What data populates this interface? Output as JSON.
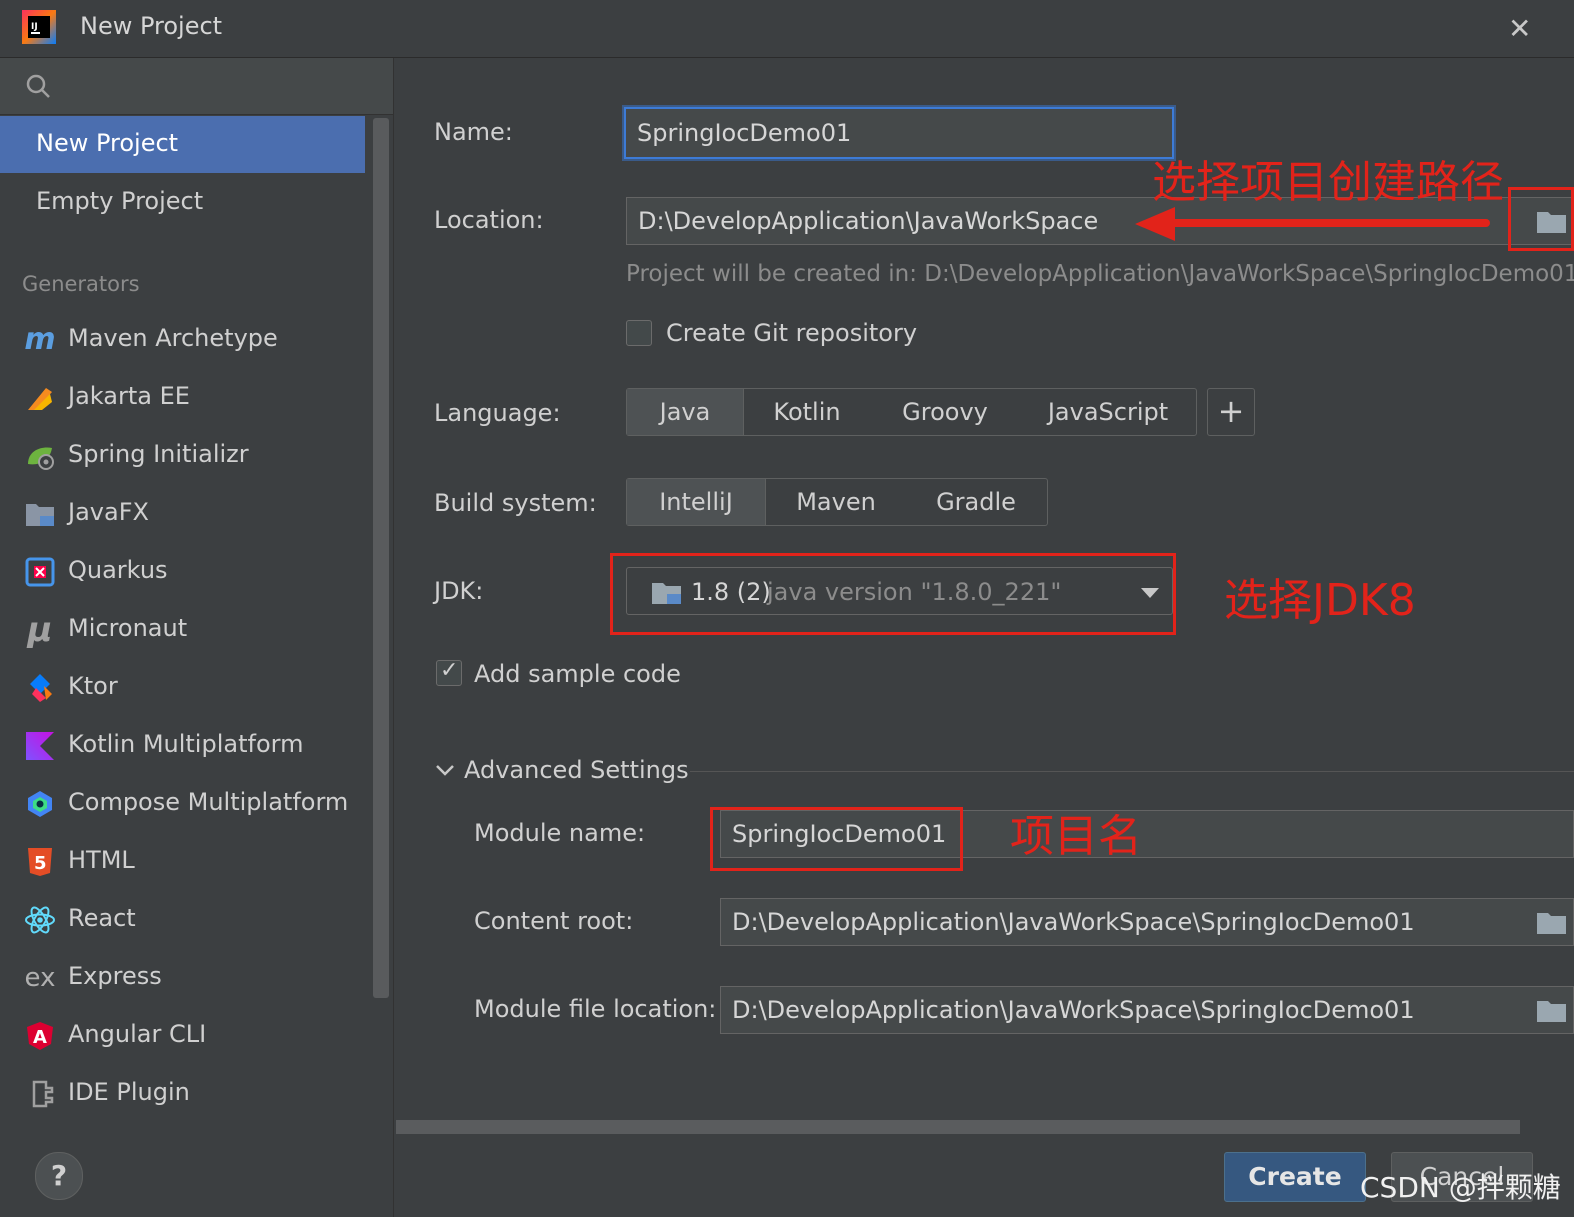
{
  "window": {
    "title": "New Project",
    "close_glyph": "✕"
  },
  "sidebar": {
    "items": [
      {
        "label": "New Project",
        "active": true
      },
      {
        "label": "Empty Project",
        "active": false
      }
    ],
    "generators_header": "Generators",
    "generators": [
      {
        "label": "Maven Archetype",
        "icon": "maven-icon"
      },
      {
        "label": "Jakarta EE",
        "icon": "jakarta-icon"
      },
      {
        "label": "Spring Initializr",
        "icon": "spring-icon"
      },
      {
        "label": "JavaFX",
        "icon": "javafx-icon"
      },
      {
        "label": "Quarkus",
        "icon": "quarkus-icon"
      },
      {
        "label": "Micronaut",
        "icon": "micronaut-icon"
      },
      {
        "label": "Ktor",
        "icon": "ktor-icon"
      },
      {
        "label": "Kotlin Multiplatform",
        "icon": "kotlin-icon"
      },
      {
        "label": "Compose Multiplatform",
        "icon": "compose-icon"
      },
      {
        "label": "HTML",
        "icon": "html5-icon"
      },
      {
        "label": "React",
        "icon": "react-icon"
      },
      {
        "label": "Express",
        "icon": "express-icon"
      },
      {
        "label": "Angular CLI",
        "icon": "angular-icon"
      },
      {
        "label": "IDE Plugin",
        "icon": "plugin-icon"
      }
    ],
    "help_glyph": "?"
  },
  "form": {
    "name_label": "Name:",
    "name_value": "SpringIocDemo01",
    "location_label": "Location:",
    "location_value": "D:\\DevelopApplication\\JavaWorkSpace",
    "location_hint": "Project will be created in: D:\\DevelopApplication\\JavaWorkSpace\\SpringIocDemo01",
    "git_label": "Create Git repository",
    "git_checked": false,
    "language_label": "Language:",
    "languages": [
      "Java",
      "Kotlin",
      "Groovy",
      "JavaScript"
    ],
    "language_selected": "Java",
    "add_glyph": "+",
    "build_label": "Build system:",
    "build_systems": [
      "IntelliJ",
      "Maven",
      "Gradle"
    ],
    "build_selected": "IntelliJ",
    "jdk_label": "JDK:",
    "jdk_version": "1.8 (2)",
    "jdk_desc": "java version \"1.8.0_221\"",
    "sample_label": "Add sample code",
    "sample_checked": true,
    "advanced_label": "Advanced Settings",
    "module_name_label": "Module name:",
    "module_name_value": "SpringIocDemo01",
    "content_root_label": "Content root:",
    "content_root_value": "D:\\DevelopApplication\\JavaWorkSpace\\SpringIocDemo01",
    "module_file_label": "Module file location:",
    "module_file_value": "D:\\DevelopApplication\\JavaWorkSpace\\SpringIocDemo01"
  },
  "annotations": {
    "path": "选择项目创建路径",
    "jdk": "选择JDK8",
    "name": "项目名",
    "color": "#e2231a"
  },
  "footer": {
    "create_label": "Create",
    "cancel_label": "Cancel",
    "watermark": "CSDN @拌颗糖"
  },
  "colors": {
    "accent": "#4b6eaf",
    "background": "#3c3f41",
    "primary_button": "#365880"
  }
}
